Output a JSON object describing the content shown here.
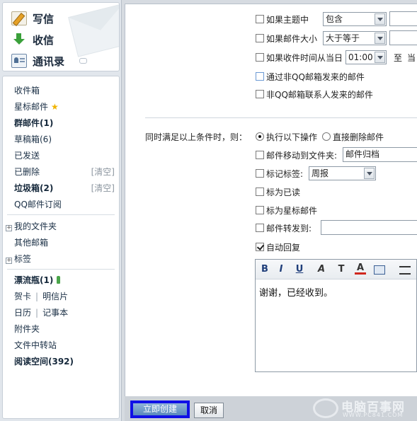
{
  "sidebar": {
    "actions": {
      "write": "写信",
      "receive": "收信",
      "contacts": "通讯录"
    },
    "folders": {
      "inbox": "收件箱",
      "starred": "星标邮件",
      "group": "群邮件(1)",
      "drafts": "草稿箱(6)",
      "sent": "已发送",
      "deleted": "已删除",
      "deleted_clear": "[清空]",
      "spam": "垃圾箱(2)",
      "spam_clear": "[清空]",
      "subscriptions": "QQ邮件订阅",
      "my_folders": "我的文件夹",
      "other_mailboxes": "其他邮箱",
      "tags": "标签",
      "drift_bottle": "漂流瓶(1)",
      "greeting_card": "贺卡",
      "postcard": "明信片",
      "calendar": "日历",
      "notepad": "记事本",
      "attachments": "附件夹",
      "file_transfer": "文件中转站",
      "reading_space": "阅读空间(392)",
      "plus_symbol": "+"
    }
  },
  "conditions": {
    "subject_label": "如果主题中",
    "subject_op": "包含",
    "size_label": "如果邮件大小",
    "size_op": "大于等于",
    "time_label": "如果收件时间从当日",
    "time_from": "01:00",
    "time_to_label": "至",
    "time_trail": "当",
    "non_qq": "通过非QQ邮箱发来的邮件",
    "non_contact": "非QQ邮箱联系人发来的邮件"
  },
  "actions": {
    "when_all_label": "同时满足以上条件时，则：",
    "do_following": "执行以下操作",
    "delete_directly": "直接删除邮件",
    "move_label": "邮件移动到文件夹:",
    "move_value": "邮件归档",
    "tag_label": "标记标签:",
    "tag_value": "周报",
    "mark_read": "标为已读",
    "mark_star": "标为星标邮件",
    "forward_label": "邮件转发到:",
    "forward_value": "",
    "auto_reply": "自动回复"
  },
  "editor": {
    "bold": "B",
    "italic": "I",
    "underline": "U",
    "font": "A",
    "size": "T",
    "color": "A",
    "content": "谢谢，已经收到。"
  },
  "footer": {
    "submit": "立即创建",
    "cancel": "取消",
    "watermark_name": "电脑百事网",
    "watermark_url": "WWW.PC841.COM"
  },
  "colors": {
    "highlight_border": "#1010e6",
    "sidebar_bg": "#e1e6ec",
    "star": "#f0b400"
  }
}
